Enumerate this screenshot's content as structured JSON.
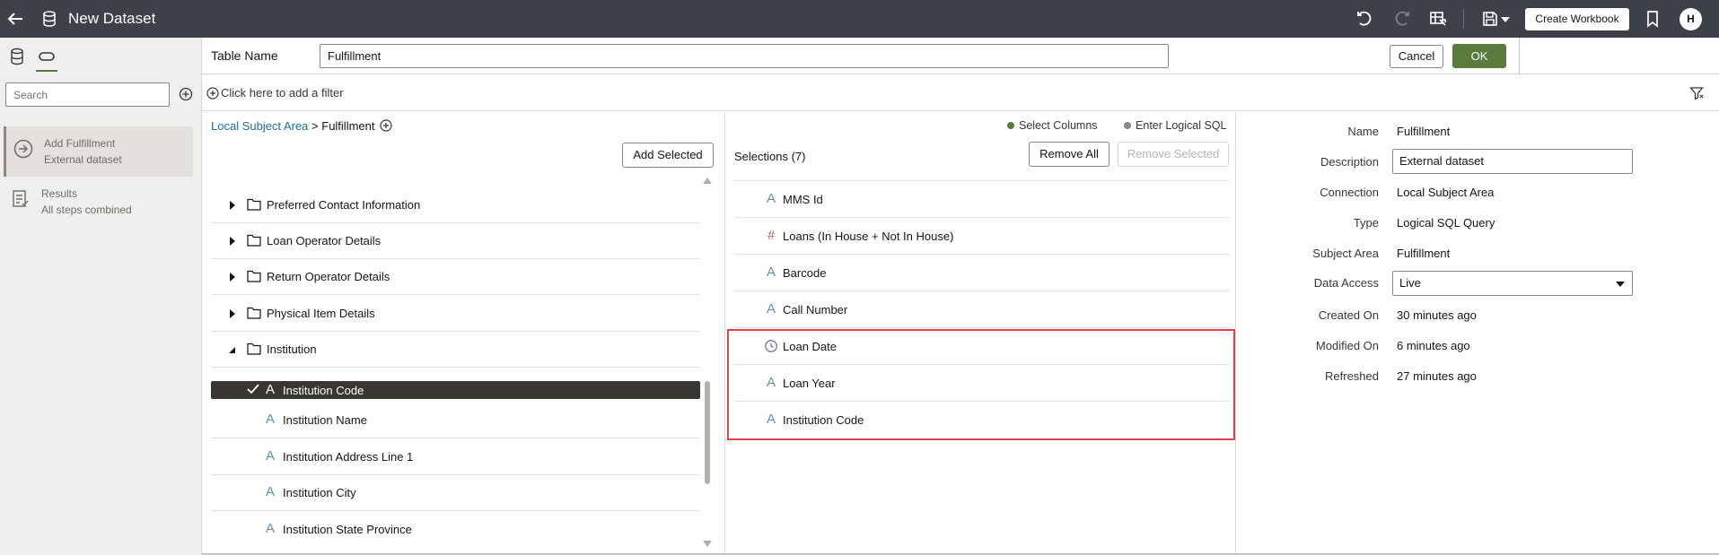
{
  "header": {
    "title": "New Dataset",
    "create_workbook_label": "Create Workbook",
    "avatar_initial": "H"
  },
  "left_panel": {
    "search_placeholder": "Search",
    "steps": [
      {
        "title": "Add Fulfillment",
        "subtitle": "External dataset"
      },
      {
        "title": "Results",
        "subtitle": "All steps combined"
      }
    ]
  },
  "table_name": {
    "label": "Table Name",
    "value": "Fulfillment",
    "cancel_label": "Cancel",
    "ok_label": "OK"
  },
  "filter": {
    "prompt": "Click here to add a filter"
  },
  "tree": {
    "breadcrumb_root": "Local Subject Area",
    "breadcrumb_separator": ">",
    "breadcrumb_current": "Fulfillment",
    "add_selected_label": "Add Selected",
    "folders": [
      {
        "label": "Preferred Contact Information"
      },
      {
        "label": "Loan Operator Details"
      },
      {
        "label": "Return Operator Details"
      },
      {
        "label": "Physical Item Details"
      },
      {
        "label": "Institution"
      }
    ],
    "columns": [
      {
        "label": "Institution Code"
      },
      {
        "label": "Institution Name"
      },
      {
        "label": "Institution Address Line 1"
      },
      {
        "label": "Institution City"
      },
      {
        "label": "Institution State Province"
      }
    ]
  },
  "selections": {
    "mode_select_columns": "Select Columns",
    "mode_logical_sql": "Enter Logical SQL",
    "title": "Selections (7)",
    "remove_all_label": "Remove All",
    "remove_selected_label": "Remove Selected",
    "items": [
      {
        "label": "MMS Id",
        "type": "text"
      },
      {
        "label": "Loans (In House + Not In House)",
        "type": "number"
      },
      {
        "label": "Barcode",
        "type": "text"
      },
      {
        "label": "Call Number",
        "type": "text"
      },
      {
        "label": "Loan Date",
        "type": "date"
      },
      {
        "label": "Loan Year",
        "type": "text"
      },
      {
        "label": "Institution Code",
        "type": "text"
      }
    ]
  },
  "properties": {
    "name_label": "Name",
    "name_value": "Fulfillment",
    "description_label": "Description",
    "description_value": "External dataset",
    "connection_label": "Connection",
    "connection_value": "Local Subject Area",
    "type_label": "Type",
    "type_value": "Logical SQL Query",
    "subject_area_label": "Subject Area",
    "subject_area_value": "Fulfillment",
    "data_access_label": "Data Access",
    "data_access_value": "Live",
    "created_label": "Created On",
    "created_value": "30 minutes ago",
    "modified_label": "Modified On",
    "modified_value": "6 minutes ago",
    "refreshed_label": "Refreshed",
    "refreshed_value": "27 minutes ago"
  },
  "colors": {
    "header_bg": "#3d4249",
    "ok_button": "#5b7a3e",
    "link": "#1d6ea0",
    "highlight": "#e0434a",
    "text_icon": "#5f8fb2",
    "number_icon": "#c0665a"
  }
}
